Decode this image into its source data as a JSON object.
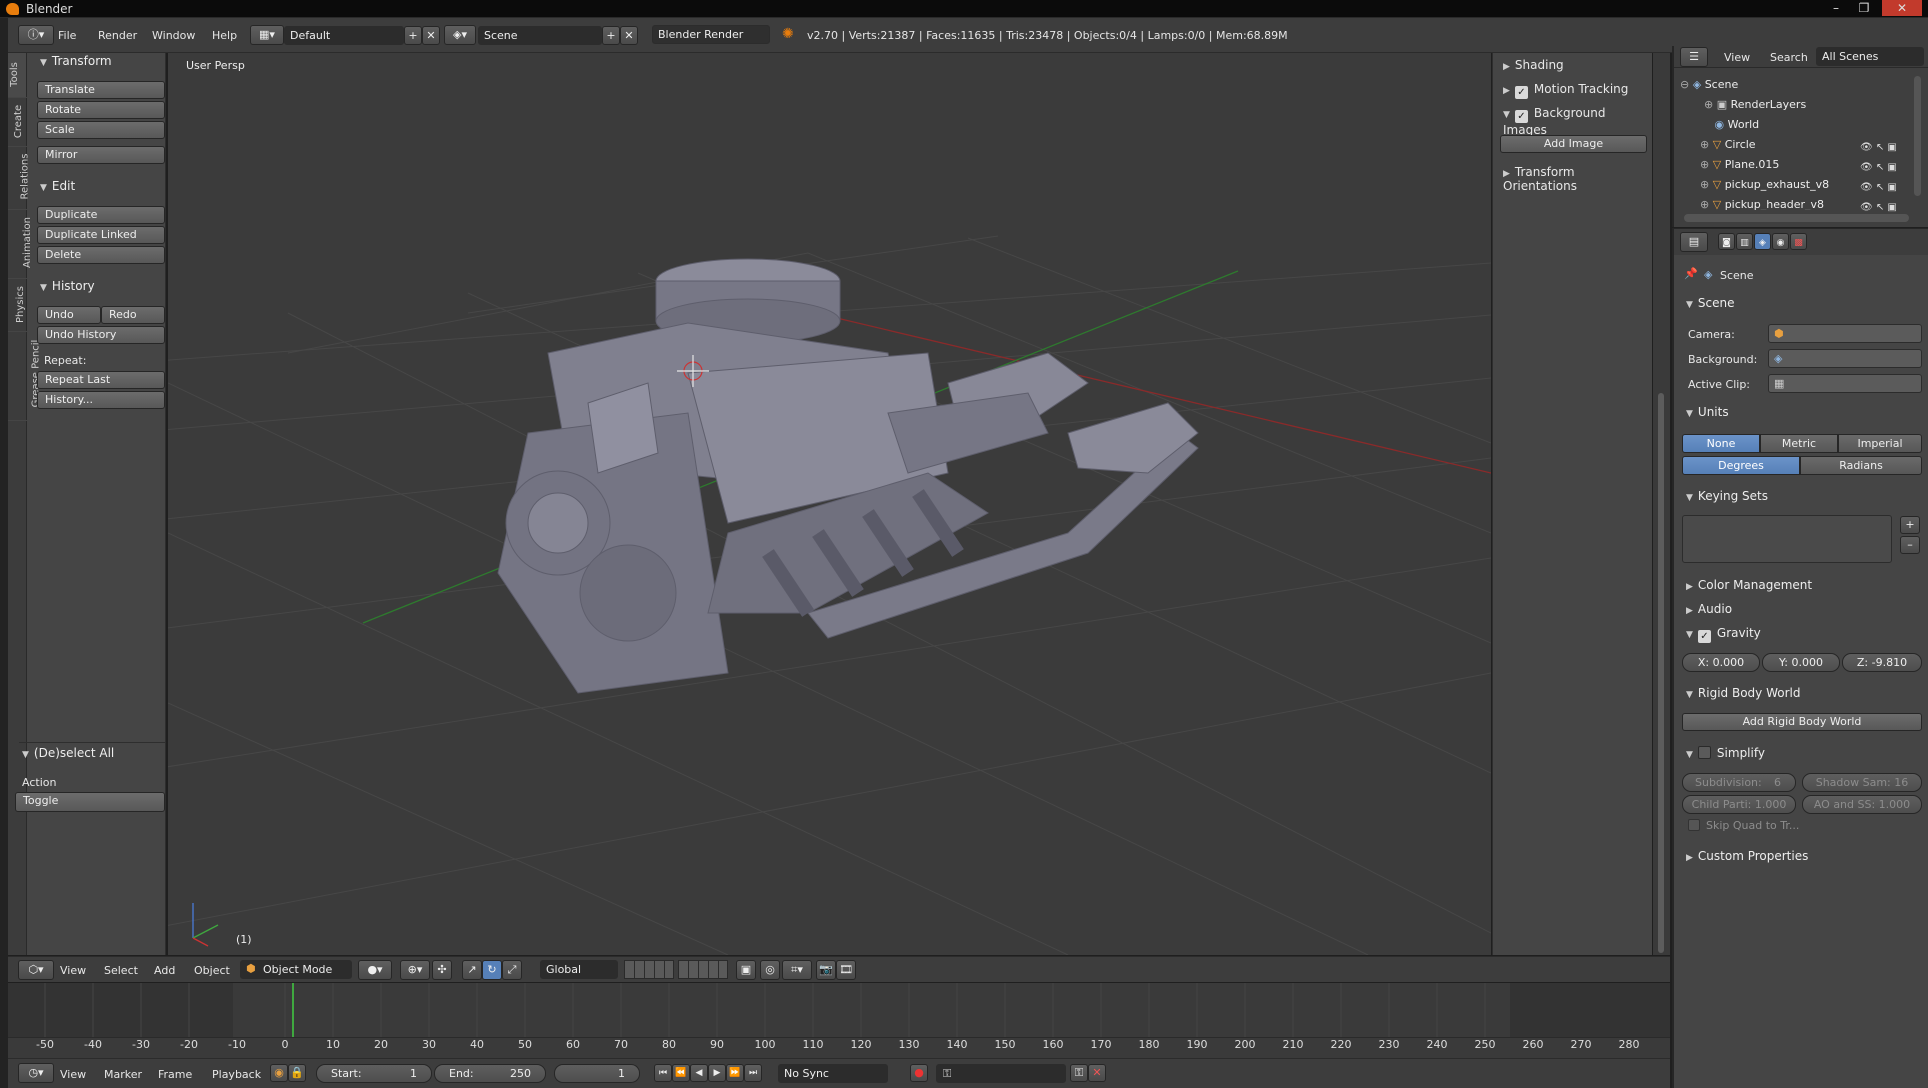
{
  "window": {
    "title": "Blender",
    "minimize": "–",
    "maximize": "❐",
    "close": "✕"
  },
  "topbar": {
    "menus": [
      "File",
      "Render",
      "Window",
      "Help"
    ],
    "screen_layout": "Default",
    "scene": "Scene",
    "engine": "Blender Render",
    "stats": "v2.70 | Verts:21387 | Faces:11635 | Tris:23478 | Objects:0/4 | Lamps:0/0 | Mem:68.89M"
  },
  "toolshelf": {
    "tabs": [
      "Tools",
      "Create",
      "Relations",
      "Animation",
      "Physics",
      "Grease Pencil"
    ],
    "transform": {
      "title": "Transform",
      "buttons": [
        "Translate",
        "Rotate",
        "Scale",
        "Mirror"
      ]
    },
    "edit": {
      "title": "Edit",
      "buttons": [
        "Duplicate",
        "Duplicate Linked",
        "Delete"
      ]
    },
    "history": {
      "title": "History",
      "undo": "Undo",
      "redo": "Redo",
      "undo_history": "Undo History",
      "repeat_label": "Repeat:",
      "repeat_last": "Repeat Last",
      "history_btn": "History..."
    },
    "operator": {
      "title": "(De)select All",
      "action_label": "Action",
      "action_value": "Toggle"
    }
  },
  "viewport": {
    "view_name": "User Persp",
    "frame_label": "(1)"
  },
  "npanel": {
    "shading": "Shading",
    "motion_tracking": "Motion Tracking",
    "background_images": "Background Images",
    "add_image": "Add Image",
    "transform_orientations": "Transform Orientations"
  },
  "outliner": {
    "view": "View",
    "search": "Search",
    "filter": "All Scenes",
    "items": [
      "Scene",
      "RenderLayers",
      "World",
      "Circle",
      "Plane.015",
      "pickup_exhaust_v8",
      "pickup_header_v8"
    ]
  },
  "properties": {
    "context": "Scene",
    "scene_panel": "Scene",
    "camera_label": "Camera:",
    "background_label": "Background:",
    "active_clip_label": "Active Clip:",
    "units_panel": "Units",
    "unit_systems": [
      "None",
      "Metric",
      "Imperial"
    ],
    "rotation_units": [
      "Degrees",
      "Radians"
    ],
    "keying_sets": "Keying Sets",
    "color_management": "Color Management",
    "audio": "Audio",
    "gravity": "Gravity",
    "gravity_x": "X:  0.000",
    "gravity_y": "Y:  0.000",
    "gravity_z": "Z:  -9.810",
    "rigid_body_world": "Rigid Body World",
    "add_rigid_body_world": "Add Rigid Body World",
    "simplify": "Simplify",
    "subdivision": "Subdivision:",
    "subdivision_val": "6",
    "shadow_samples": "Shadow Sam: 16",
    "child_particles": "Child Parti: 1.000",
    "ao_sss": "AO and SS: 1.000",
    "skip_quad": "Skip Quad to Tr...",
    "custom_properties": "Custom Properties"
  },
  "viewport_header": {
    "menus": [
      "View",
      "Select",
      "Add",
      "Object"
    ],
    "mode": "Object Mode",
    "orientation": "Global"
  },
  "timeline": {
    "ticks": [
      "-50",
      "-40",
      "-30",
      "-20",
      "-10",
      "0",
      "10",
      "20",
      "30",
      "40",
      "50",
      "60",
      "70",
      "80",
      "90",
      "100",
      "110",
      "120",
      "130",
      "140",
      "150",
      "160",
      "170",
      "180",
      "190",
      "200",
      "210",
      "220",
      "230",
      "240",
      "250",
      "260",
      "270",
      "280"
    ],
    "current_frame": 1,
    "menus": [
      "View",
      "Marker",
      "Frame",
      "Playback"
    ],
    "start_label": "Start:",
    "start_val": "1",
    "end_label": "End:",
    "end_val": "250",
    "frame_val": "1",
    "sync": "No Sync"
  },
  "colors": {
    "accent": "#5680b8",
    "orange": "#e87d0d",
    "grid": "#4a4a4a",
    "x_axis": "#8a2a2a",
    "y_axis": "#2e7a2e",
    "playhead": "#3fa83f"
  }
}
